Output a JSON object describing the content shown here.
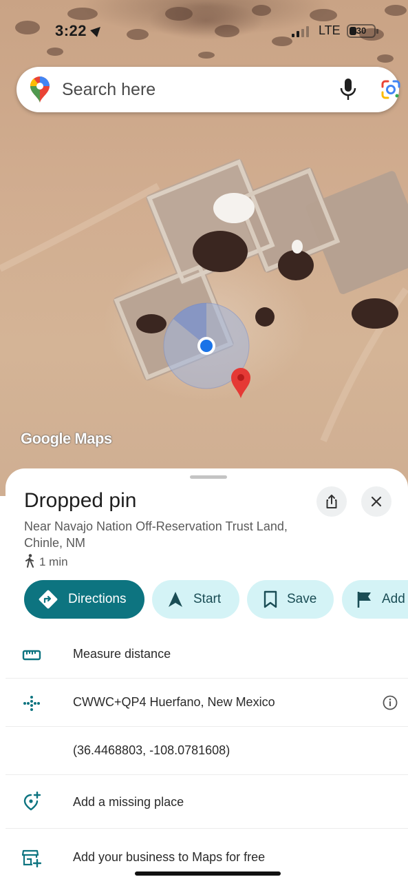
{
  "status_bar": {
    "time": "3:22",
    "network": "LTE",
    "battery_level": "30",
    "battery_fraction": 0.3
  },
  "search": {
    "placeholder": "Search here"
  },
  "map": {
    "watermark": "Google Maps"
  },
  "place": {
    "title": "Dropped pin",
    "subtitle": "Near Navajo Nation Off-Reservation Trust Land, Chinle, NM",
    "walk_time": "1 min"
  },
  "actions": [
    {
      "label": "Directions",
      "icon": "directions-icon"
    },
    {
      "label": "Start",
      "icon": "navigation-arrow-icon"
    },
    {
      "label": "Save",
      "icon": "bookmark-icon"
    },
    {
      "label": "Add",
      "icon": "flag-icon"
    }
  ],
  "details": {
    "measure": "Measure distance",
    "plus_code": "CWWC+QP4 Huerfano, New Mexico",
    "coordinates": "(36.4468803, -108.0781608)",
    "missing_place": "Add a missing place",
    "business": "Add your business to Maps for free"
  },
  "colors": {
    "accent": "#0d7480",
    "chip_bg": "#d4f3f6",
    "pin_red": "#e53935",
    "location_blue": "#1a73e8"
  }
}
